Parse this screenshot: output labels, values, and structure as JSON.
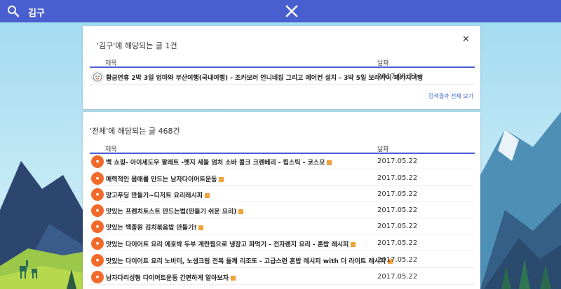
{
  "search": {
    "query": "김구"
  },
  "card1": {
    "title": "'김구'에 해당되는 글 1건",
    "col_title": "제목",
    "col_date": "날짜",
    "rows": [
      {
        "title": "황금연휴 2박 3일 엄마와 부산여행(국내여행) - 조카보러 언니네집 그리고 에어컨 설치 - 3박 5일 보라카이 패키지여행",
        "date": "2017.05.21"
      }
    ],
    "view_all": "검색결과 전체 보기"
  },
  "card2": {
    "title": "'전체'에 해당되는 글 468건",
    "col_title": "제목",
    "col_date": "날짜",
    "rows": [
      {
        "title": "백 쇼핑- 아이세도우 팔레트 -펫지 세들 엄처 소바 콜크 크렌베리 - 립스틱 - 코스모",
        "date": "2017.05.22"
      },
      {
        "title": "매력적인 몸매를 만드는 남자다이어트운동",
        "date": "2017.05.22"
      },
      {
        "title": "망고푸딩 만들기~디저트 요리레시피",
        "date": "2017.05.22"
      },
      {
        "title": "맛있는 프렌치토스트 만드는법(만들기 쉬운 요리)",
        "date": "2017.05.22"
      },
      {
        "title": "맛있는 백종원 김치볶음밥 만들기!",
        "date": "2017.05.22"
      },
      {
        "title": "맛있는 다이어트 요리 에호박 두부 계란찜으로 냉장고 파먹기 - 전자렌지 요리 - 혼밥 레시피",
        "date": "2017.05.22"
      },
      {
        "title": "맛있는 다이어트 요리 노바터, 노생크림 전복 들깨 리조또 - 고급스런 혼밥 레시피 with 더 라이트 레시피",
        "date": "2017.05.22"
      },
      {
        "title": "남자다리성형 다이어트운동 간편하게 알아보자",
        "date": "2017.05.22"
      }
    ]
  },
  "colors": {
    "accent": "#4a5fcf",
    "link": "#3b67c8",
    "avatar": "#f26a2a"
  },
  "icons": {
    "search": "search-icon",
    "close": "close-icon"
  }
}
